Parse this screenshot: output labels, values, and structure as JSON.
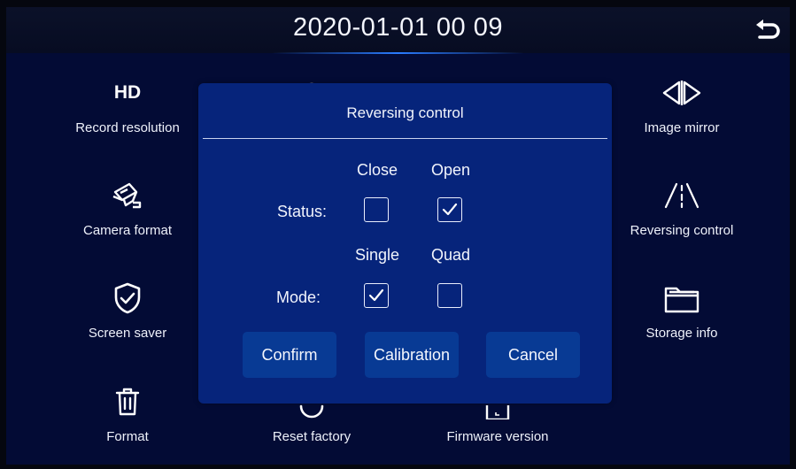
{
  "header": {
    "datetime": "2020-01-01  00 09"
  },
  "tiles": {
    "record_resolution": {
      "icon_text": "HD",
      "label": "Record resolution"
    },
    "camera_format": {
      "label": "Camera format"
    },
    "screen_saver": {
      "label": "Screen saver"
    },
    "format": {
      "label": "Format"
    },
    "reset_factory": {
      "label": "Reset factory"
    },
    "firmware_version": {
      "label": "Firmware version"
    },
    "image_mirror": {
      "label": "Image mirror"
    },
    "reversing_control": {
      "label": "Reversing control"
    },
    "storage_info": {
      "label": "Storage info"
    }
  },
  "dialog": {
    "title": "Reversing control",
    "status": {
      "label": "Status:",
      "options": [
        {
          "label": "Close",
          "checked": false
        },
        {
          "label": "Open",
          "checked": true
        }
      ]
    },
    "mode": {
      "label": "Mode:",
      "options": [
        {
          "label": "Single",
          "checked": true
        },
        {
          "label": "Quad",
          "checked": false
        }
      ]
    },
    "buttons": {
      "confirm": "Confirm",
      "calibration": "Calibration",
      "cancel": "Cancel"
    }
  },
  "colors": {
    "background": "#030b35",
    "dialog": "#06247b",
    "button": "#083a94",
    "text": "#f2f4fb",
    "accent_glow": "#2a7cff"
  },
  "icons": {
    "back": "return-arrow-icon",
    "camera_format": "cctv-camera-icon",
    "screen_saver": "shield-check-icon",
    "format": "trash-icon",
    "image_mirror": "mirror-arrows-icon",
    "reversing_control": "road-lanes-icon",
    "storage_info": "folder-icon"
  }
}
